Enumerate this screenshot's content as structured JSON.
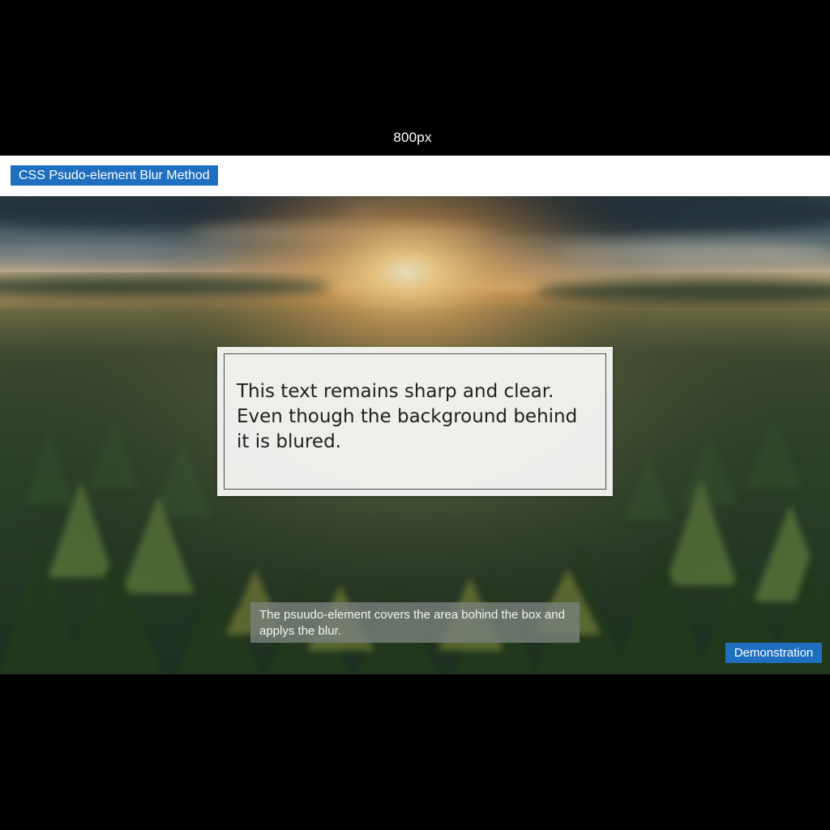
{
  "header": {
    "width_label": "800px"
  },
  "title_bar": {
    "title": "CSS Psudo-element Blur Method"
  },
  "card": {
    "lines": [
      "This text remains sharp and clear.",
      "Even though the background behind",
      "it is blured."
    ]
  },
  "caption": {
    "lines": [
      "The psuudo-element covers the area bohind the box and",
      "applys the blur."
    ]
  },
  "badge": {
    "label": "Demonstration"
  },
  "colors": {
    "badge_blue": "#1e6fc0",
    "page_background": "#000000",
    "title_bar_background": "#ffffff",
    "card_background": "#f5f5f3"
  }
}
